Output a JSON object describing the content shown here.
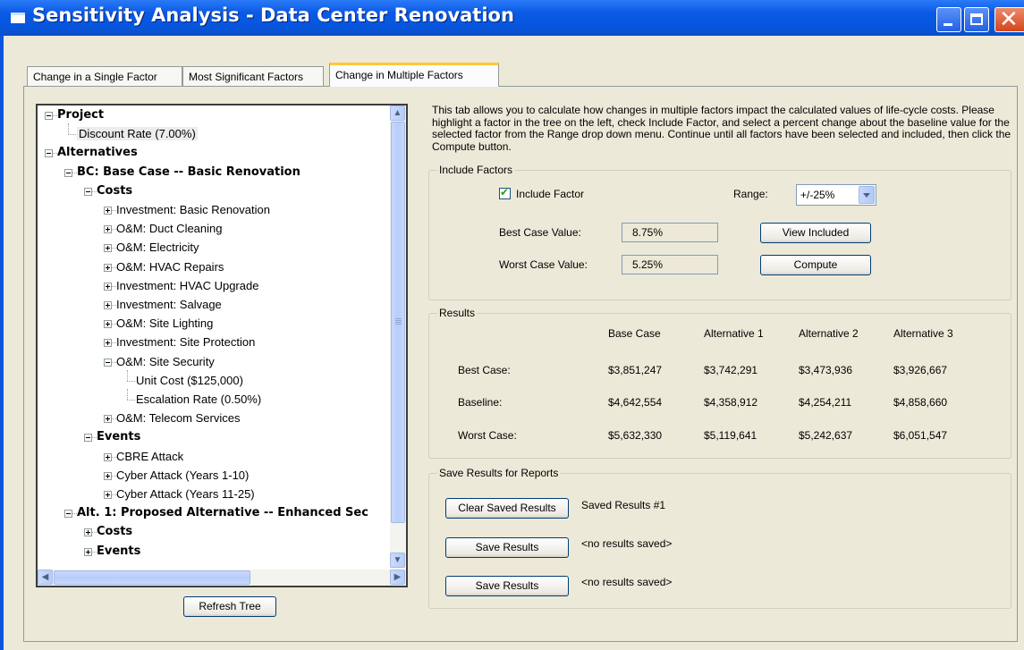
{
  "window": {
    "title": "Sensitivity Analysis - Data Center Renovation",
    "controls": [
      "minimize",
      "maximize",
      "close"
    ]
  },
  "tabs": [
    {
      "label": "Change in a Single Factor",
      "active": false
    },
    {
      "label": "Most Significant Factors",
      "active": false
    },
    {
      "label": "Change in Multiple Factors",
      "active": true
    }
  ],
  "tree": {
    "nodes": [
      {
        "label": "Project",
        "bold": true,
        "expander": "minus"
      },
      {
        "label": "Discount Rate (7.00%)",
        "bold": false,
        "selected": true
      },
      {
        "label": "Alternatives",
        "bold": true,
        "expander": "minus"
      },
      {
        "label": "BC: Base Case -- Basic Renovation",
        "bold": true,
        "expander": "minus"
      },
      {
        "label": "Costs",
        "bold": true,
        "expander": "minus"
      },
      {
        "label": "Investment: Basic Renovation",
        "expander": "plus"
      },
      {
        "label": "O&M: Duct Cleaning",
        "expander": "plus"
      },
      {
        "label": "O&M: Electricity",
        "expander": "plus"
      },
      {
        "label": "O&M: HVAC Repairs",
        "expander": "plus"
      },
      {
        "label": "Investment: HVAC Upgrade",
        "expander": "plus"
      },
      {
        "label": "Investment: Salvage",
        "expander": "plus"
      },
      {
        "label": "O&M: Site Lighting",
        "expander": "plus"
      },
      {
        "label": "Investment: Site Protection",
        "expander": "plus"
      },
      {
        "label": "O&M: Site Security",
        "expander": "minus"
      },
      {
        "label": "Unit Cost ($125,000)"
      },
      {
        "label": "Escalation Rate (0.50%)"
      },
      {
        "label": "O&M: Telecom Services",
        "expander": "plus"
      },
      {
        "label": "Events",
        "bold": true,
        "expander": "minus"
      },
      {
        "label": "CBRE Attack",
        "expander": "plus"
      },
      {
        "label": "Cyber Attack (Years 1-10)",
        "expander": "plus"
      },
      {
        "label": "Cyber Attack (Years 11-25)",
        "expander": "plus"
      },
      {
        "label": "Alt. 1: Proposed Alternative -- Enhanced Sec",
        "bold": true,
        "expander": "minus"
      },
      {
        "label": "Costs",
        "bold": true,
        "expander": "plus"
      },
      {
        "label": "Events",
        "bold": true,
        "expander": "plus"
      }
    ],
    "refresh_label": "Refresh Tree"
  },
  "description": "This tab allows you to calculate how changes in multiple factors impact the calculated values of life-cycle costs.  Please highlight a factor in the tree on the left, check Include Factor, and select a percent change about the baseline value for the selected factor from the Range drop down menu. Continue until all factors have been selected and included, then click the Compute button.",
  "include_factors": {
    "group_label": "Include Factors",
    "include_label": "Include Factor",
    "include_checked": true,
    "range_label": "Range:",
    "range_value": "+/-25%",
    "best_label": "Best Case Value:",
    "best_value": "8.75%",
    "worst_label": "Worst Case Value:",
    "worst_value": "5.25%",
    "view_included_label": "View Included",
    "compute_label": "Compute"
  },
  "results": {
    "group_label": "Results",
    "columns": [
      "Base Case",
      "Alternative 1",
      "Alternative 2",
      "Alternative 3"
    ],
    "rows": [
      {
        "label": "Best Case:",
        "values": [
          "$3,851,247",
          "$3,742,291",
          "$3,473,936",
          "$3,926,667"
        ]
      },
      {
        "label": "Baseline:",
        "values": [
          "$4,642,554",
          "$4,358,912",
          "$4,254,211",
          "$4,858,660"
        ]
      },
      {
        "label": "Worst Case:",
        "values": [
          "$5,632,330",
          "$5,119,641",
          "$5,242,637",
          "$6,051,547"
        ]
      }
    ]
  },
  "save": {
    "group_label": "Save Results for Reports",
    "rows": [
      {
        "button": "Clear Saved Results",
        "status": "Saved Results #1"
      },
      {
        "button": "Save Results",
        "status": "<no results saved>"
      },
      {
        "button": "Save Results",
        "status": "<no results saved>"
      }
    ]
  }
}
